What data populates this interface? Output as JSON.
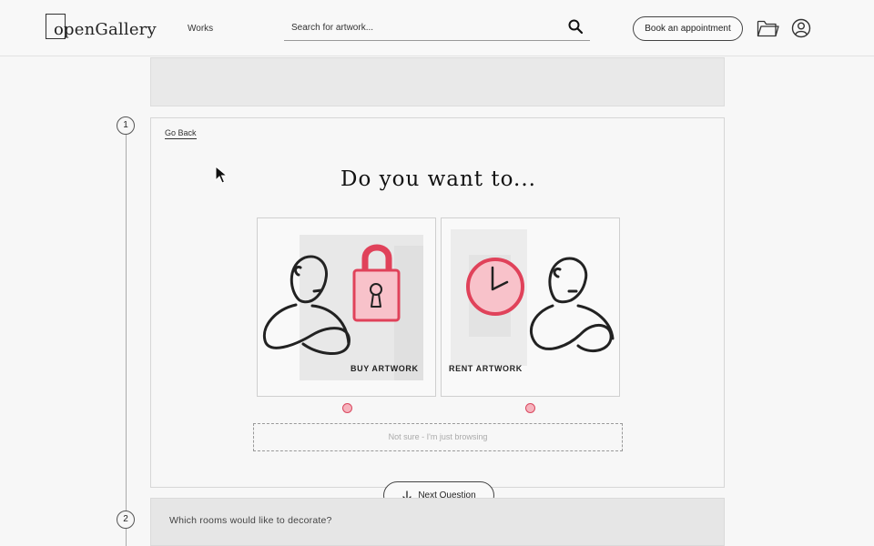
{
  "header": {
    "logo_text": "openGallery",
    "nav_works": "Works",
    "search_placeholder": "Search for artwork...",
    "appointment_button": "Book an appointment",
    "icons": [
      "search-icon",
      "folder-icon",
      "user-icon"
    ]
  },
  "steps": [
    {
      "number": "1"
    },
    {
      "number": "2"
    }
  ],
  "question": {
    "go_back": "Go Back",
    "title": "Do you want to...",
    "options": [
      {
        "label": "BUY ARTWORK",
        "icon": "lock-icon"
      },
      {
        "label": "RENT ARTWORK",
        "icon": "clock-icon"
      }
    ],
    "not_sure": "Not sure - I'm just browsing"
  },
  "next_button": "Next Question",
  "question2": {
    "text": "Which rooms would like to decorate?"
  },
  "colors": {
    "accent": "#e0425a",
    "radio_fill": "#f6b3bd",
    "text": "#222222",
    "background": "#f7f7f7"
  }
}
